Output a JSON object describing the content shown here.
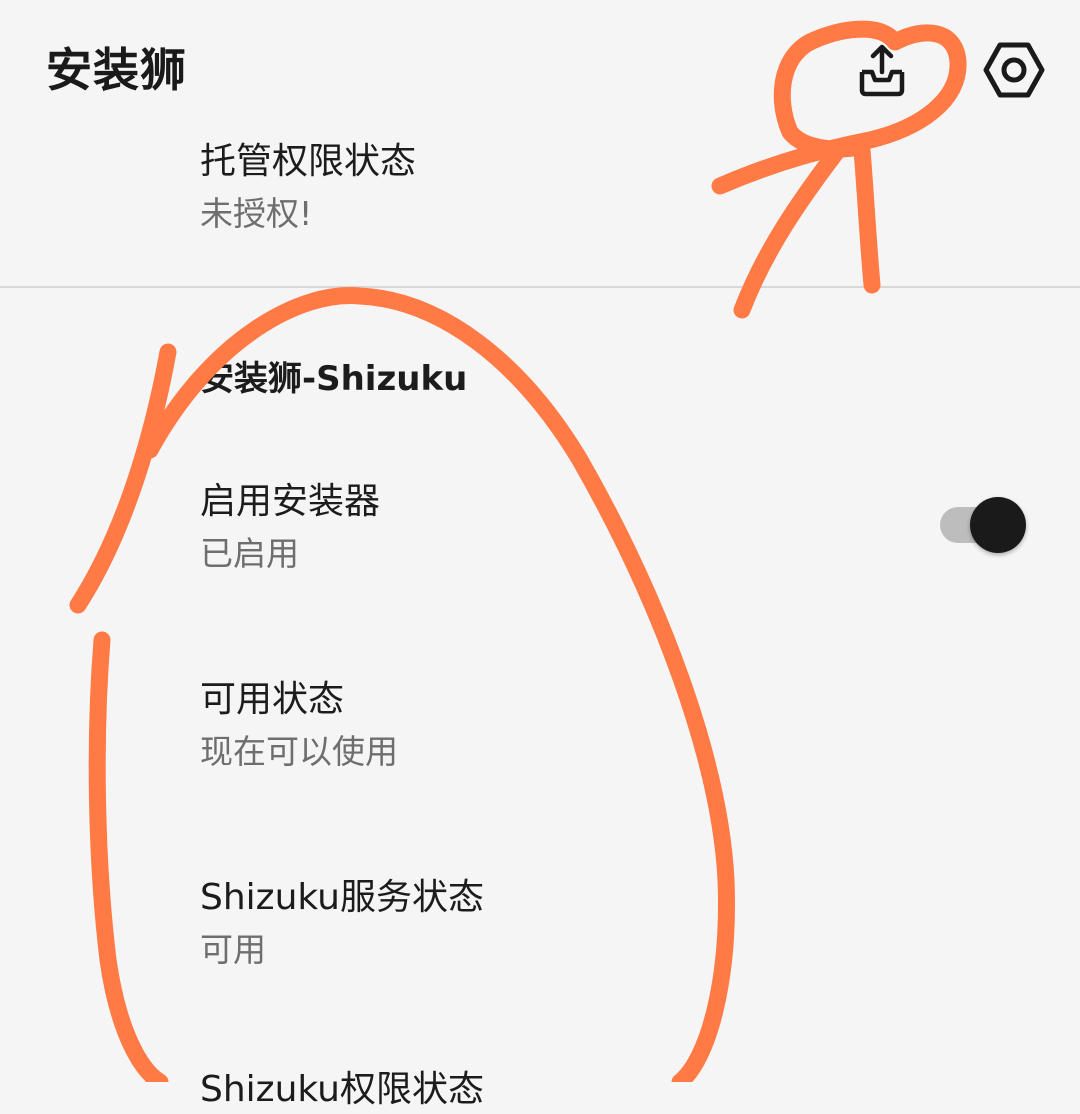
{
  "app_bar": {
    "title": "安装狮",
    "export_icon": "export-tray-icon",
    "settings_icon": "settings-gear-icon"
  },
  "managed_permission": {
    "title": "托管权限状态",
    "summary": "未授权!"
  },
  "category": {
    "title": "安装狮-Shizuku"
  },
  "enable_installer": {
    "title": "启用安装器",
    "summary": "已启用",
    "switch_on": true
  },
  "availability": {
    "title": "可用状态",
    "summary": "现在可以使用"
  },
  "shizuku_service": {
    "title": "Shizuku服务状态",
    "summary": "可用"
  },
  "shizuku_permission": {
    "title": "Shizuku权限状态"
  },
  "colors": {
    "background": "#f5f5f5",
    "annotation_stroke": "#ff7a45",
    "switch_thumb": "#1a1a1a",
    "switch_track": "#bdbdbd"
  }
}
